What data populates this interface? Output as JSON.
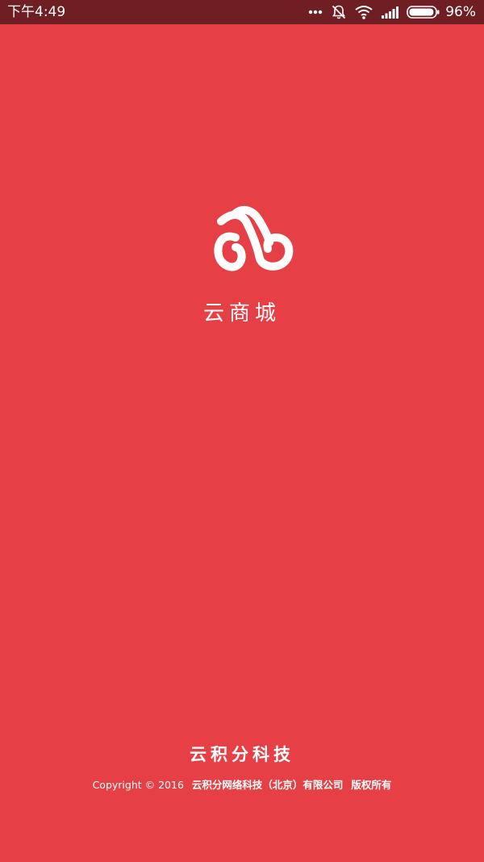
{
  "status_bar": {
    "time": "下午4:49",
    "battery_percent_text": "96%",
    "battery_level": 0.96,
    "icons": [
      "more-dots-icon",
      "notification-muted-icon",
      "wifi-icon",
      "signal-icon",
      "battery-icon"
    ]
  },
  "splash": {
    "app_name": "云商城",
    "background_color": "#e64046",
    "logo_icon": "cloud-logo-icon"
  },
  "footer": {
    "company_name": "云积分科技",
    "copyright_prefix": "Copyright © 2016",
    "legal_name": "云积分网络科技（北京）有限公司",
    "rights": "版权所有"
  }
}
